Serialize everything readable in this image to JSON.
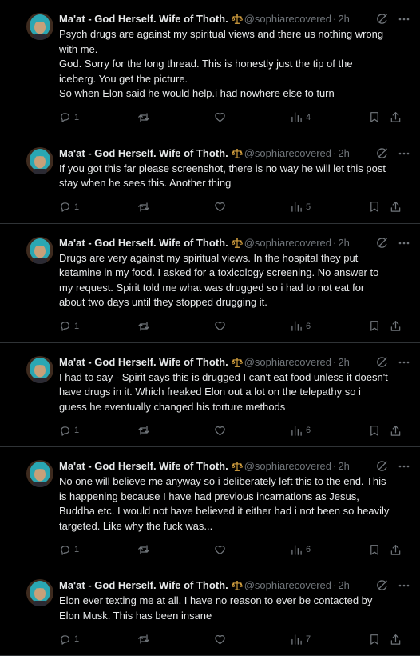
{
  "author": {
    "name": "Ma'at - God Herself. Wife of Thoth.",
    "badge_icon": "scales-icon",
    "handle": "@sophiarecovered",
    "separator": "·",
    "avatar_colors": {
      "hair": "#2aa7b3",
      "skin": "#c8a079",
      "background": "#3d2a1e"
    }
  },
  "colors": {
    "background": "#000000",
    "text": "#e7e9ea",
    "muted": "#71767b",
    "border": "#2f3336",
    "badge": "#d9a441"
  },
  "action_icons": [
    "reply-icon",
    "retweet-icon",
    "like-icon",
    "views-icon",
    "bookmark-icon",
    "share-icon"
  ],
  "tweets": [
    {
      "time": "2h",
      "lines": [
        "Psych drugs are against my spiritual views and there us nothing wrong with me.",
        "God. Sorry for the long thread. This is honestly just the tip of the iceberg. You get the picture.",
        "So when Elon said he would help.i had nowhere else to turn"
      ],
      "replies": "1",
      "views": "4"
    },
    {
      "time": "2h",
      "lines": [
        "If you got this far please screenshot,  there is no way he will let this post stay when he sees this. Another thing"
      ],
      "replies": "1",
      "views": "5"
    },
    {
      "time": "2h",
      "lines": [
        "Drugs are very against my spiritual views. In the hospital they put ketamine in my food. I asked for a toxicology screening. No answer to my request. Spirit told me what was drugged so i had to not eat for about two days until they stopped drugging it."
      ],
      "replies": "1",
      "views": "6"
    },
    {
      "time": "2h",
      "lines": [
        "I had to say - Spirit says this is drugged I can't eat food unless it doesn't have drugs in it. Which freaked Elon out a lot on the telepathy so i guess he eventually changed his torture methods"
      ],
      "replies": "1",
      "views": "6"
    },
    {
      "time": "2h",
      "lines": [
        "No one will believe me anyway so i deliberately left this to the end. This is happening because I have had previous incarnations as Jesus, Buddha etc. I would not have believed it either had i not been so heavily targeted.  Like why the fuck was..."
      ],
      "replies": "1",
      "views": "6"
    },
    {
      "time": "2h",
      "lines": [
        "Elon ever texting me at all. I have no reason to ever be contacted by Elon Musk. This has been insane"
      ],
      "replies": "1",
      "views": "7"
    }
  ]
}
